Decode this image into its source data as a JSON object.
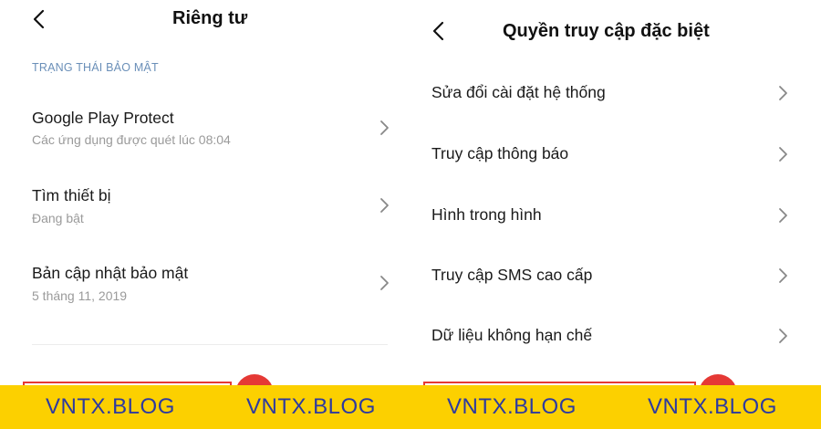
{
  "left_screen": {
    "title": "Riêng tư",
    "section_label": "TRẠNG THÁI BẢO MẬT",
    "items": [
      {
        "title": "Google Play Protect",
        "subtitle": "Các ứng dụng được quét lúc 08:04"
      },
      {
        "title": "Tìm thiết bị",
        "subtitle": "Đang bật"
      },
      {
        "title": "Bản cập nhật bảo mật",
        "subtitle": "5 tháng 11, 2019"
      }
    ]
  },
  "right_screen": {
    "title": "Quyền truy cập đặc biệt",
    "items": [
      {
        "title": "Sửa đổi cài đặt hệ thống"
      },
      {
        "title": "Truy cập thông báo"
      },
      {
        "title": "Hình trong hình"
      },
      {
        "title": "Truy cập SMS cao cấp"
      },
      {
        "title": "Dữ liệu không hạn chế"
      }
    ]
  },
  "watermark": {
    "labels": [
      "VNTX.BLOG",
      "VNTX.BLOG",
      "VNTX.BLOG",
      "VNTX.BLOG"
    ],
    "background_color": "#fcd000",
    "text_color": "#2d3aa0"
  },
  "colors": {
    "section_label": "#6a8fb8",
    "highlight": "#e53935",
    "secondary_text": "#9a9a9a"
  },
  "icons": {
    "back": "chevron-left-icon",
    "row_arrow": "chevron-right-icon"
  }
}
